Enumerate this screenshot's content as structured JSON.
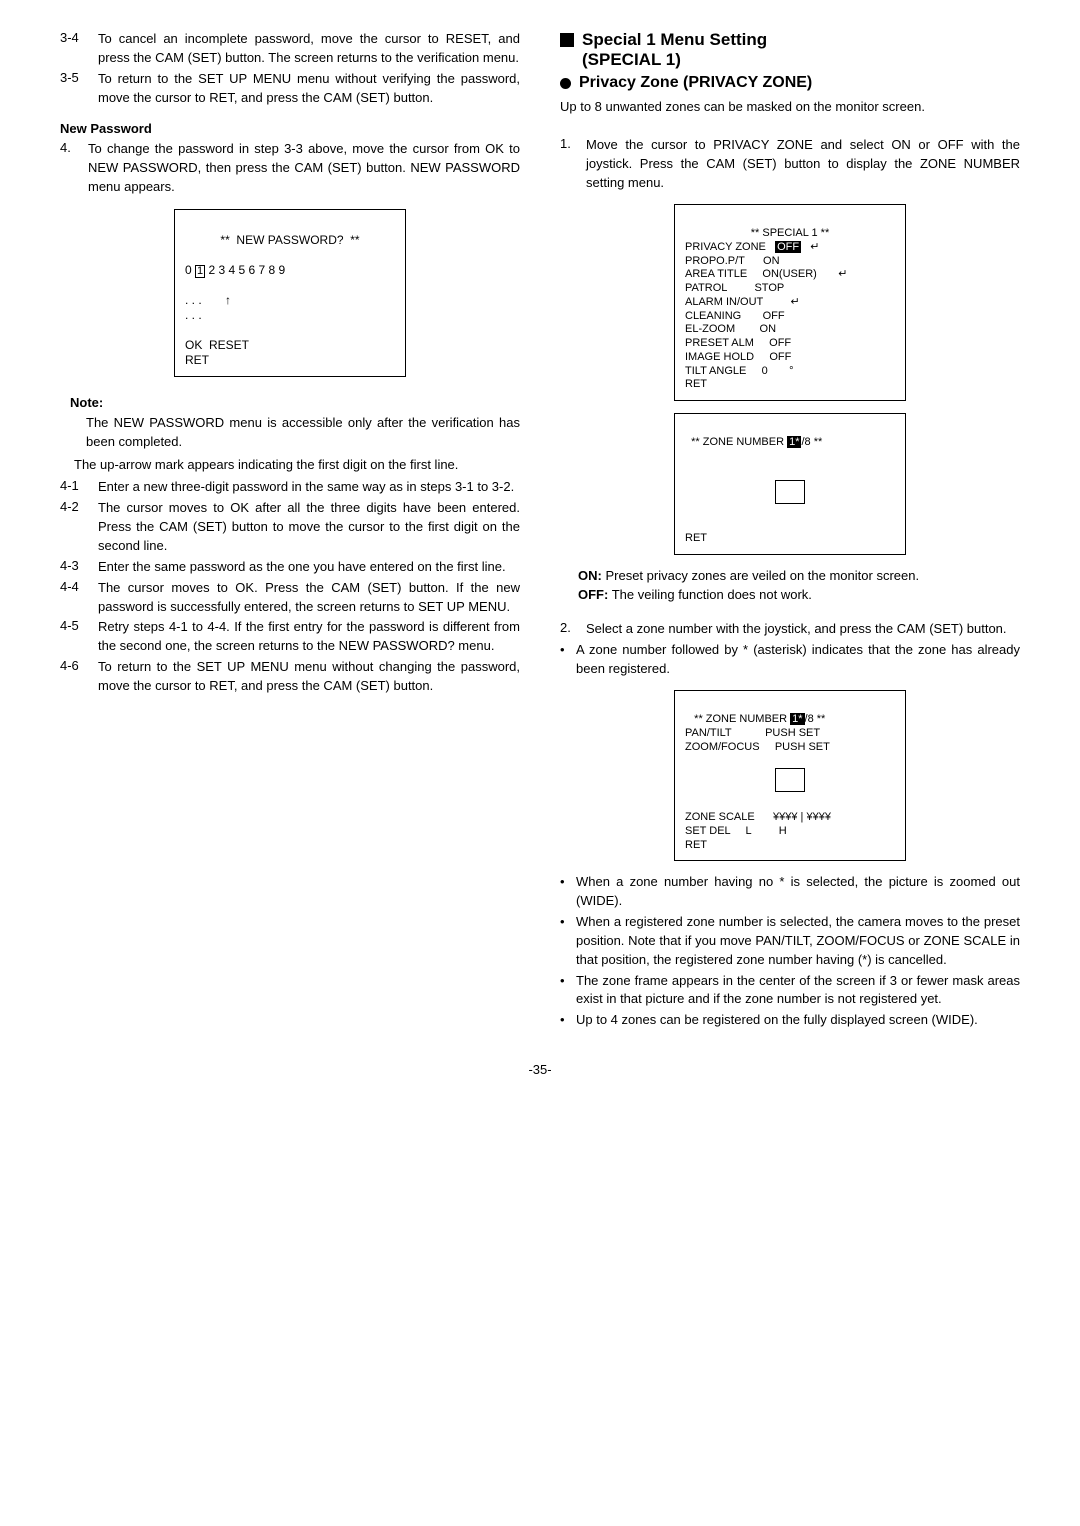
{
  "left": {
    "step34_num": "3-4",
    "step34": "To cancel an incomplete password, move the cursor to RESET, and press the CAM (SET) button. The screen returns to the verification menu.",
    "step35_num": "3-5",
    "step35": "To return to the SET UP MENU menu without verifying the password, move the cursor to RET, and press the CAM (SET) button.",
    "new_password_heading": "New Password",
    "step4_num": "4.",
    "step4": "To change the password in step 3-3 above, move the cursor from OK to NEW PASSWORD, then press the CAM (SET) button. NEW PASSWORD menu appears.",
    "menu_title": "**  NEW PASSWORD?  **",
    "menu_digits": "0 1 2 3 4 5 6 7 8 9",
    "menu_dots1": ". . .       ↑",
    "menu_dots2": ". . .",
    "menu_footer1": "OK  RESET",
    "menu_footer2": "RET",
    "note_heading": "Note:",
    "note_body": "The NEW PASSWORD menu is accessible only after the verification has been completed.",
    "uparrow_note": "The up-arrow mark appears indicating the first digit on the first line.",
    "step41_num": "4-1",
    "step41": "Enter a new three-digit password in the same way as in steps 3-1 to 3-2.",
    "step42_num": "4-2",
    "step42": "The cursor moves to OK after all the three digits have been entered. Press the CAM (SET) button to move the cursor to the first digit on the second line.",
    "step43_num": "4-3",
    "step43": "Enter the same password as the one you have entered on the first line.",
    "step44_num": "4-4",
    "step44": "The cursor moves to OK. Press the CAM (SET) button. If the new password is successfully entered, the screen returns to SET UP MENU.",
    "step45_num": "4-5",
    "step45": "Retry steps 4-1 to 4-4. If the first entry for the password is different from the second one, the screen returns to the NEW PASSWORD? menu.",
    "step46_num": "4-6",
    "step46": "To return to the SET UP MENU menu without changing the password, move the cursor to RET, and press the CAM (SET) button."
  },
  "right": {
    "h1a": "Special 1 Menu Setting",
    "h1b": "(SPECIAL 1)",
    "h2": "Privacy Zone (PRIVACY ZONE)",
    "intro": "Up to 8 unwanted zones can be masked on the monitor screen.",
    "step1_num": "1.",
    "step1": "Move the cursor to PRIVACY ZONE and select ON or OFF with the joystick. Press the CAM (SET) button to display the ZONE NUMBER setting menu.",
    "menuA_title": "** SPECIAL 1 **",
    "menuA_l1": "PRIVACY ZONE   OFF   ↵",
    "menuA_l2": "PROPO.P/T      ON",
    "menuA_l3": "AREA TITLE     ON(USER)       ↵",
    "menuA_l4": "PATROL         STOP",
    "menuA_l5": "ALARM IN/OUT         ↵",
    "menuA_l6": "CLEANING       OFF",
    "menuA_l7": "EL-ZOOM        ON",
    "menuA_l8": "PRESET ALM     OFF",
    "menuA_l9": "IMAGE HOLD     OFF",
    "menuA_l10": "TILT ANGLE     0       °",
    "menuA_l11": "RET",
    "menuB_title": "** ZONE NUMBER 1*/8 **",
    "menuB_ret": "RET",
    "on_label": "ON:",
    "on_text": "Preset privacy zones are veiled on the monitor screen.",
    "off_label": "OFF:",
    "off_text": "The veiling function does not work.",
    "step2_num": "2.",
    "step2": "Select a zone number with the joystick, and press the CAM (SET) button.",
    "step2b": "A zone number followed by * (asterisk) indicates that the zone has already been registered.",
    "menuC_title": "** ZONE NUMBER 1*/8 **",
    "menuC_l1": "PAN/TILT           PUSH SET",
    "menuC_l2": "ZOOM/FOCUS     PUSH SET",
    "menuC_l3": "ZONE SCALE      ¥¥¥¥ | ¥¥¥¥",
    "menuC_l4": "SET DEL     L         H",
    "menuC_l5": "RET",
    "b1": "When a zone number having no * is selected, the picture is zoomed out (WIDE).",
    "b2": "When a registered zone number is selected, the camera moves to the preset position. Note that if you move PAN/TILT, ZOOM/FOCUS or ZONE SCALE in that position, the registered zone number having (*) is cancelled.",
    "b3": "The zone frame appears in the center of the screen if 3 or fewer mask areas exist in that picture and if the zone number is not registered yet.",
    "b4": "Up to 4 zones can be registered on the fully displayed screen (WIDE)."
  },
  "page": "-35-"
}
